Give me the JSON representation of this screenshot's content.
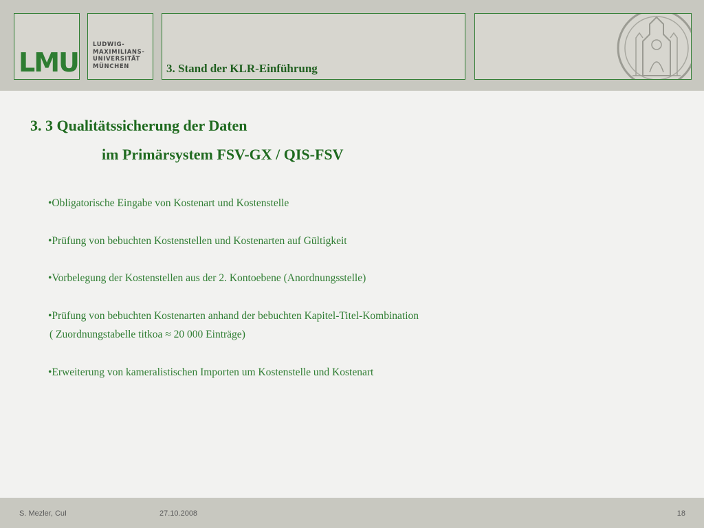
{
  "header": {
    "logo_text": "LMU",
    "university_lines": [
      "LUDWIG-",
      "MAXIMILIANS-",
      "UNIVERSITÄT",
      "MÜNCHEN"
    ],
    "section_title": "3. Stand der KLR-Einführung",
    "seal_icon": "university-seal-icon"
  },
  "slide": {
    "title": "3. 3  Qualitätssicherung der Daten",
    "subtitle": "im Primärsystem FSV-GX / QIS-FSV",
    "bullets": [
      "•Obligatorische Eingabe von Kostenart und Kostenstelle",
      "•Prüfung von bebuchten Kostenstellen und Kostenarten auf Gültigkeit",
      "•Vorbelegung der Kostenstellen aus der 2. Kontoebene (Anordnungsstelle)",
      "•Prüfung von bebuchten Kostenarten anhand der bebuchten Kapitel-Titel-Kombination",
      "•Erweiterung von kameralistischen Importen um Kostenstelle und Kostenart"
    ],
    "bullet_4_continuation": " ( Zuordnungstabelle  titkoa ≈ 20 000 Einträge)"
  },
  "footer": {
    "author": "S. Mezler, CuI",
    "date": "27.10.2008",
    "page_number": "18"
  },
  "colors": {
    "accent_green": "#2f7d32",
    "header_bg": "#c8c8c0",
    "page_bg": "#f2f2f0"
  }
}
